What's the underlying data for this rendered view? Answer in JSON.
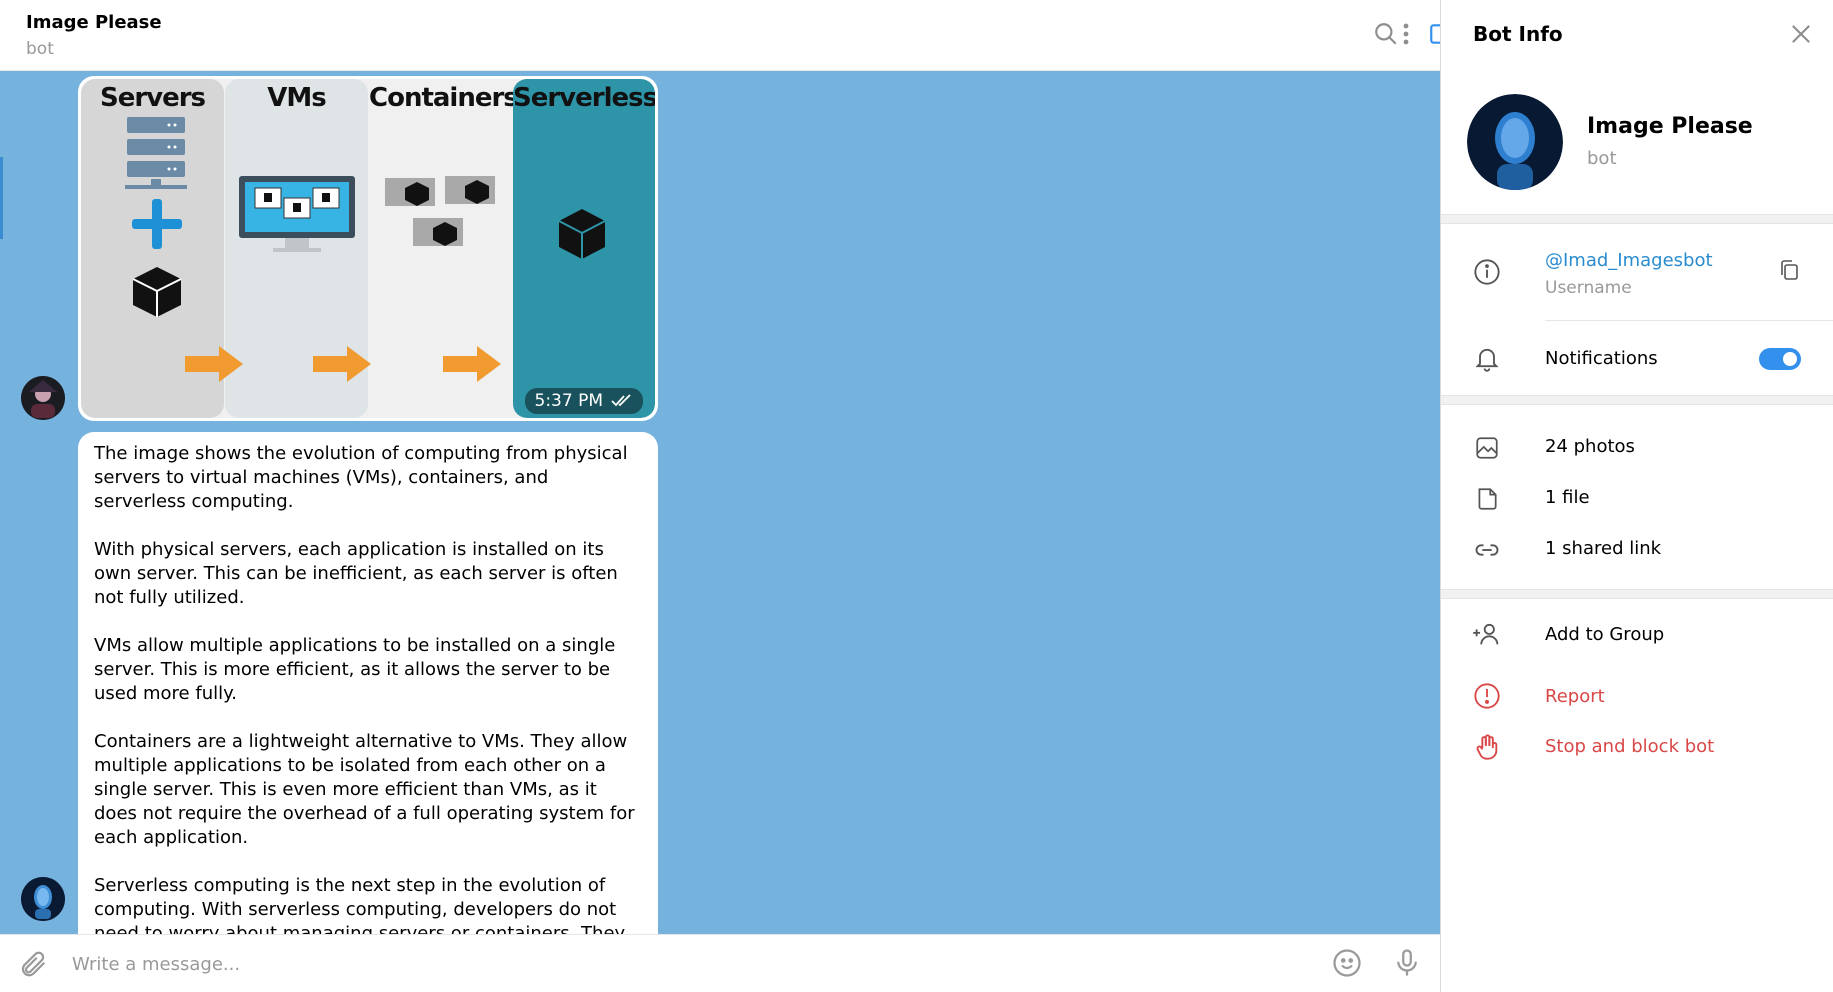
{
  "chat": {
    "title": "Image Please",
    "subtitle": "bot",
    "header_icons": [
      "search-icon",
      "sidebar-toggle-icon",
      "more-vertical-icon"
    ],
    "photo": {
      "columns": [
        "Servers",
        "VMs",
        "Containers",
        "Serverless"
      ],
      "time": "5:37 PM"
    },
    "message_paragraphs": [
      "The image shows the evolution of computing from physical servers to virtual machines (VMs), containers, and serverless computing.",
      "With physical servers, each application is installed on its own server. This can be inefficient, as each server is often not fully utilized.",
      "VMs allow multiple applications to be installed on a single server. This is more efficient, as it allows the server to be used more fully.",
      "Containers are a lightweight alternative to VMs. They allow multiple applications to be isolated from each other on a single server. This is even more efficient than VMs, as it does not require the overhead of a full operating system for each application.",
      "Serverless computing is the next step in the evolution of computing. With serverless computing, developers do not need to worry about managing servers or containers. They simply"
    ],
    "composer": {
      "placeholder": "Write a message..."
    }
  },
  "panel": {
    "title": "Bot Info",
    "name": "Image Please",
    "subtitle": "bot",
    "username": "@Imad_Imagesbot",
    "username_caption": "Username",
    "notifications_label": "Notifications",
    "notifications_on": true,
    "media": {
      "photos": "24 photos",
      "files": "1 file",
      "links": "1 shared link"
    },
    "actions": {
      "add_to_group": "Add to Group",
      "report": "Report",
      "stop_block": "Stop and block bot"
    }
  },
  "colors": {
    "chat_background": "#75b3de",
    "accent": "#3390ec",
    "link": "#2a8bd0",
    "danger": "#d94747",
    "serverless_teal": "#2e95a8"
  }
}
